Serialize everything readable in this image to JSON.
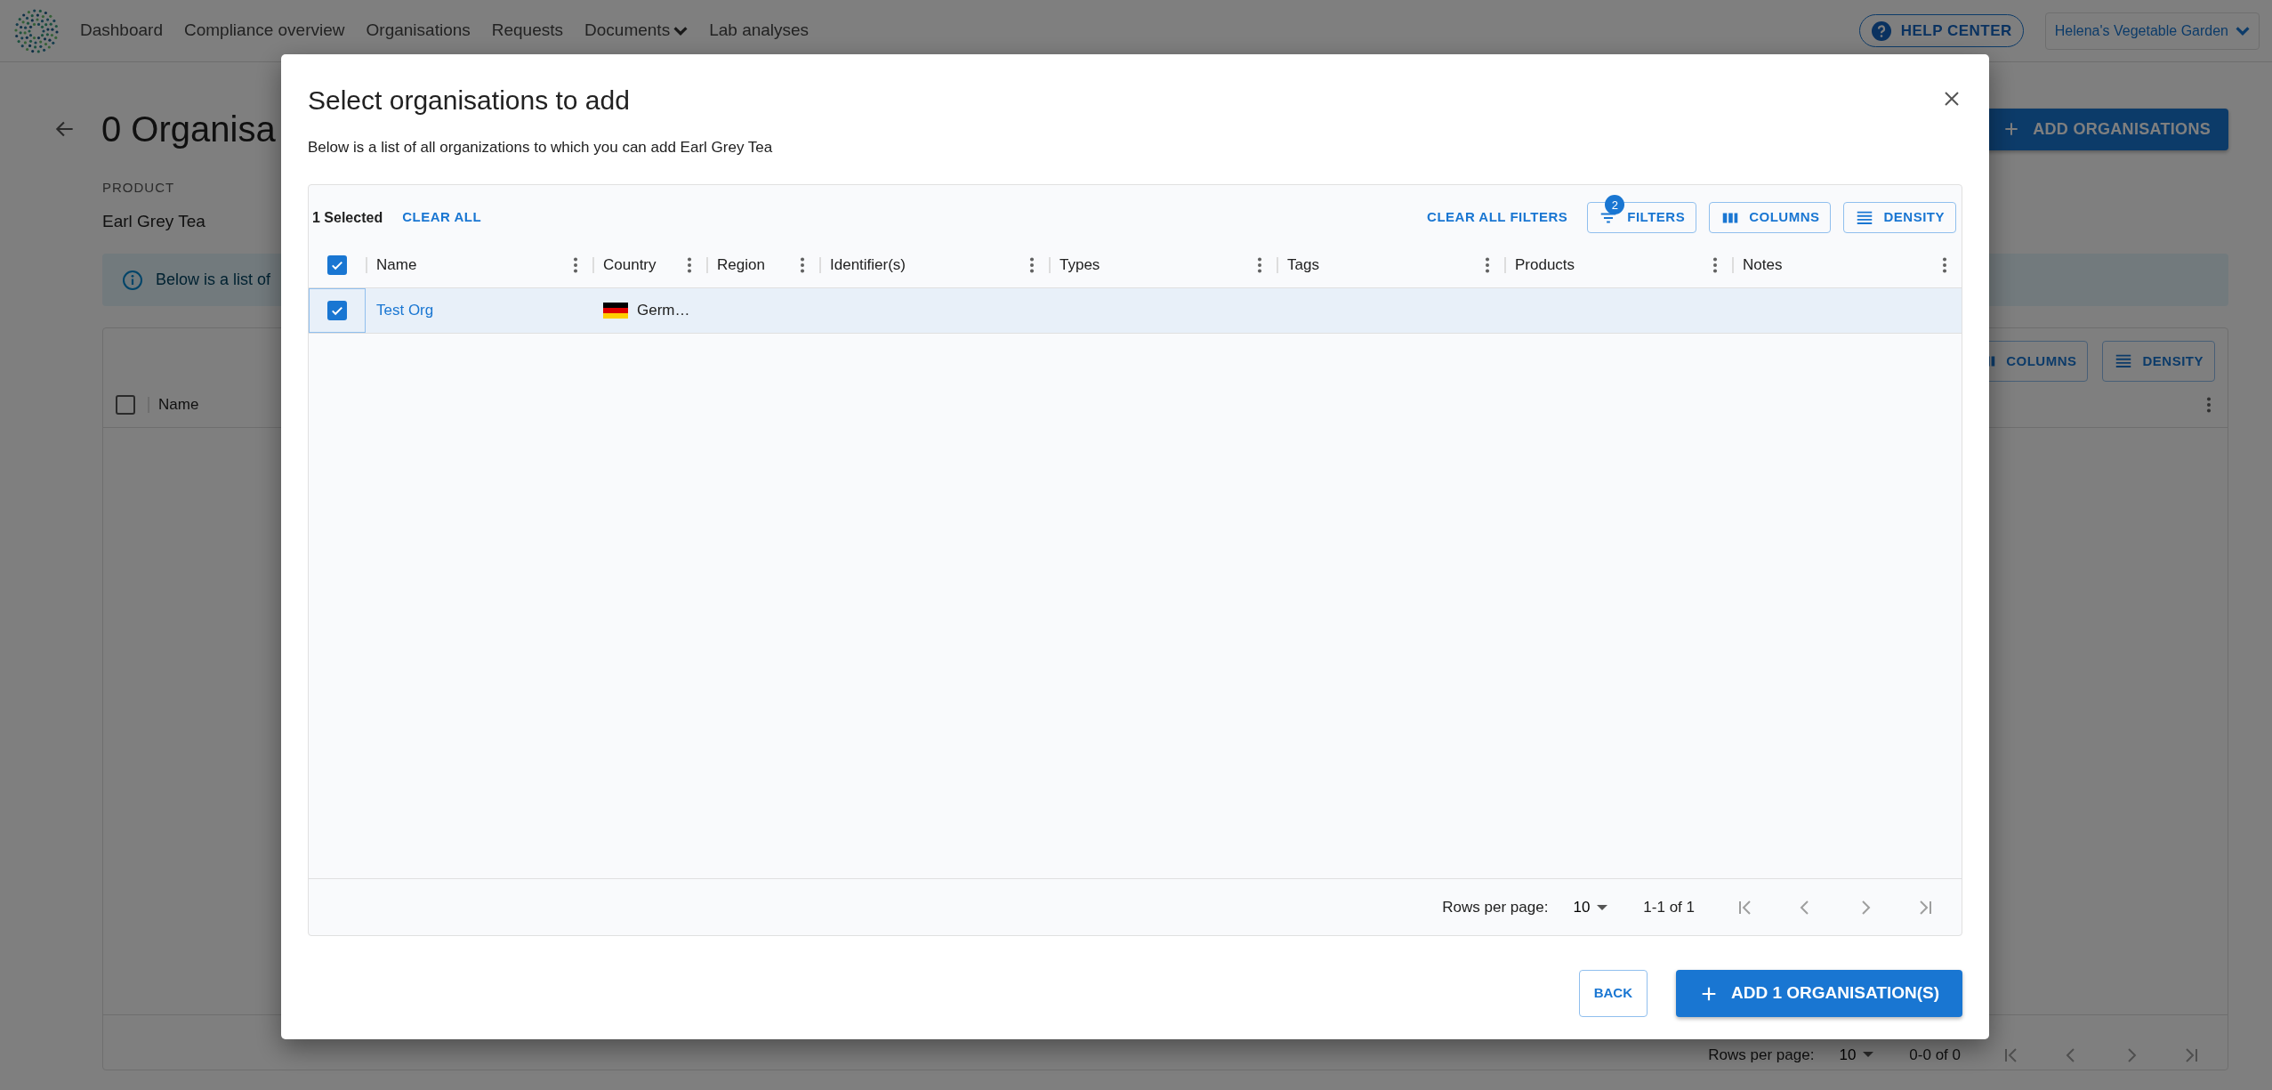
{
  "nav": {
    "items": [
      {
        "label": "Dashboard",
        "kind": "link"
      },
      {
        "label": "Compliance overview",
        "kind": "link"
      },
      {
        "label": "Organisations",
        "kind": "link"
      },
      {
        "label": "Requests",
        "kind": "link"
      },
      {
        "label": "Documents",
        "kind": "dropdown"
      },
      {
        "label": "Lab analyses",
        "kind": "link"
      }
    ],
    "help": "HELP CENTER",
    "account": "Helena's Vegetable Garden"
  },
  "page": {
    "title": "0 Organisa",
    "product_label": "PRODUCT",
    "product": "Earl Grey Tea",
    "alert": "Below is a list of",
    "add_button": "ADD ORGANISATIONS",
    "grid": {
      "columns_button": "COLUMNS",
      "density_button": "DENSITY",
      "header_checked": false,
      "column": "Name",
      "rows_label": "Rows per page:",
      "rows_value": "10",
      "range": "0-0 of 0"
    }
  },
  "dialog": {
    "title": "Select organisations to add",
    "description": "Below is a list of all organizations to which you can add Earl Grey Tea",
    "selected_count": "1 Selected",
    "clear_all": "CLEAR ALL",
    "clear_filters": "CLEAR ALL FILTERS",
    "filters": "FILTERS",
    "filter_count": "2",
    "columns_button": "COLUMNS",
    "density_button": "DENSITY",
    "select_all_checked": true,
    "columns": [
      "Name",
      "Country",
      "Region",
      "Identifier(s)",
      "Types",
      "Tags",
      "Products",
      "Notes"
    ],
    "rows": [
      {
        "selected": true,
        "name": "Test Org",
        "country": "Germ…"
      }
    ],
    "rows_label": "Rows per page:",
    "rows_value": "10",
    "range": "1-1 of 1",
    "back": "BACK",
    "submit": "ADD 1 ORGANISATION(S)"
  }
}
